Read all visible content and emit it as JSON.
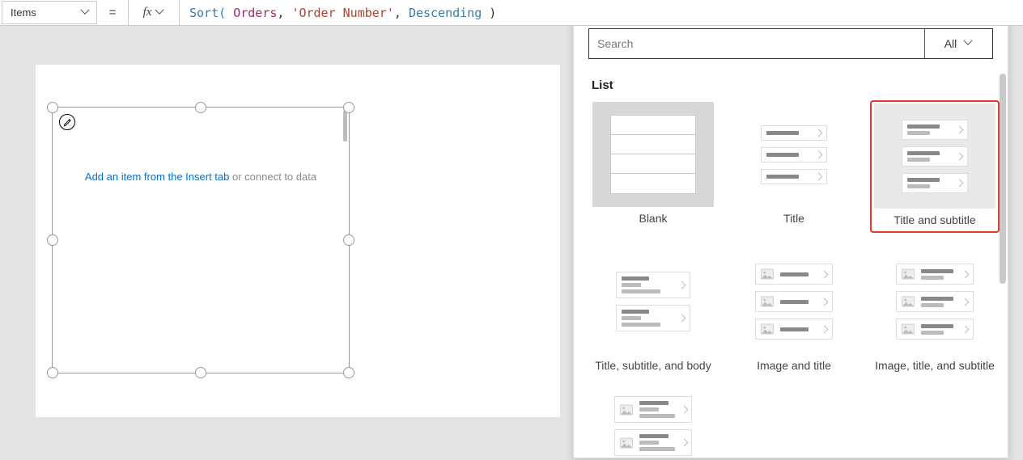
{
  "formula_bar": {
    "property": "Items",
    "equals": "=",
    "fx": "fx",
    "fn_open": "Sort( ",
    "datasource": "Orders",
    "sep1": ", ",
    "field": "'Order Number'",
    "sep2": ", ",
    "direction": "Descending",
    "fn_close": " )"
  },
  "canvas": {
    "hint_link": "Add an item from the Insert tab",
    "hint_rest": " or connect to data"
  },
  "panel": {
    "search_placeholder": "Search",
    "filter_label": "All",
    "section_title": "List",
    "cards": [
      {
        "label": "Blank"
      },
      {
        "label": "Title"
      },
      {
        "label": "Title and subtitle"
      },
      {
        "label": "Title, subtitle, and body"
      },
      {
        "label": "Image and title"
      },
      {
        "label": "Image, title, and subtitle"
      }
    ]
  }
}
